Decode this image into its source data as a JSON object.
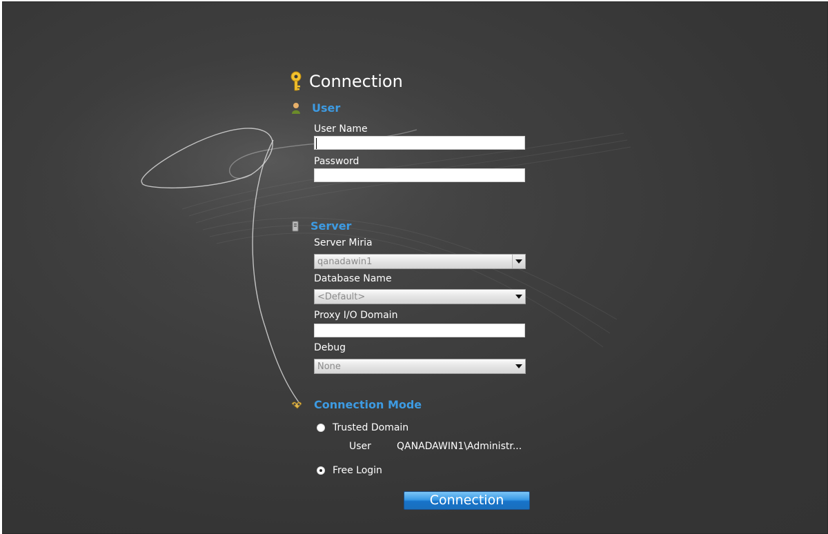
{
  "title": "Connection",
  "user_section": {
    "heading": "User",
    "username_label": "User Name",
    "username_value": "",
    "password_label": "Password",
    "password_value": ""
  },
  "server_section": {
    "heading": "Server",
    "server_label": "Server Miria",
    "server_value": "qanadawin1",
    "database_label": "Database Name",
    "database_value": "<Default>",
    "proxy_label": "Proxy I/O Domain",
    "proxy_value": "",
    "debug_label": "Debug",
    "debug_value": "None"
  },
  "mode_section": {
    "heading": "Connection Mode",
    "trusted_label": "Trusted Domain",
    "trusted_selected": false,
    "user_key": "User",
    "user_value": "QANADAWIN1\\Administr...",
    "free_label": "Free Login",
    "free_selected": true
  },
  "connect_button": "Connection",
  "icons": {
    "title": "key-icon",
    "user": "user-icon",
    "server": "server-icon",
    "mode": "handshake-icon"
  },
  "colors": {
    "background": "#3a3a3a",
    "section_heading": "#3d9be3",
    "button": "#2b8ad9"
  }
}
